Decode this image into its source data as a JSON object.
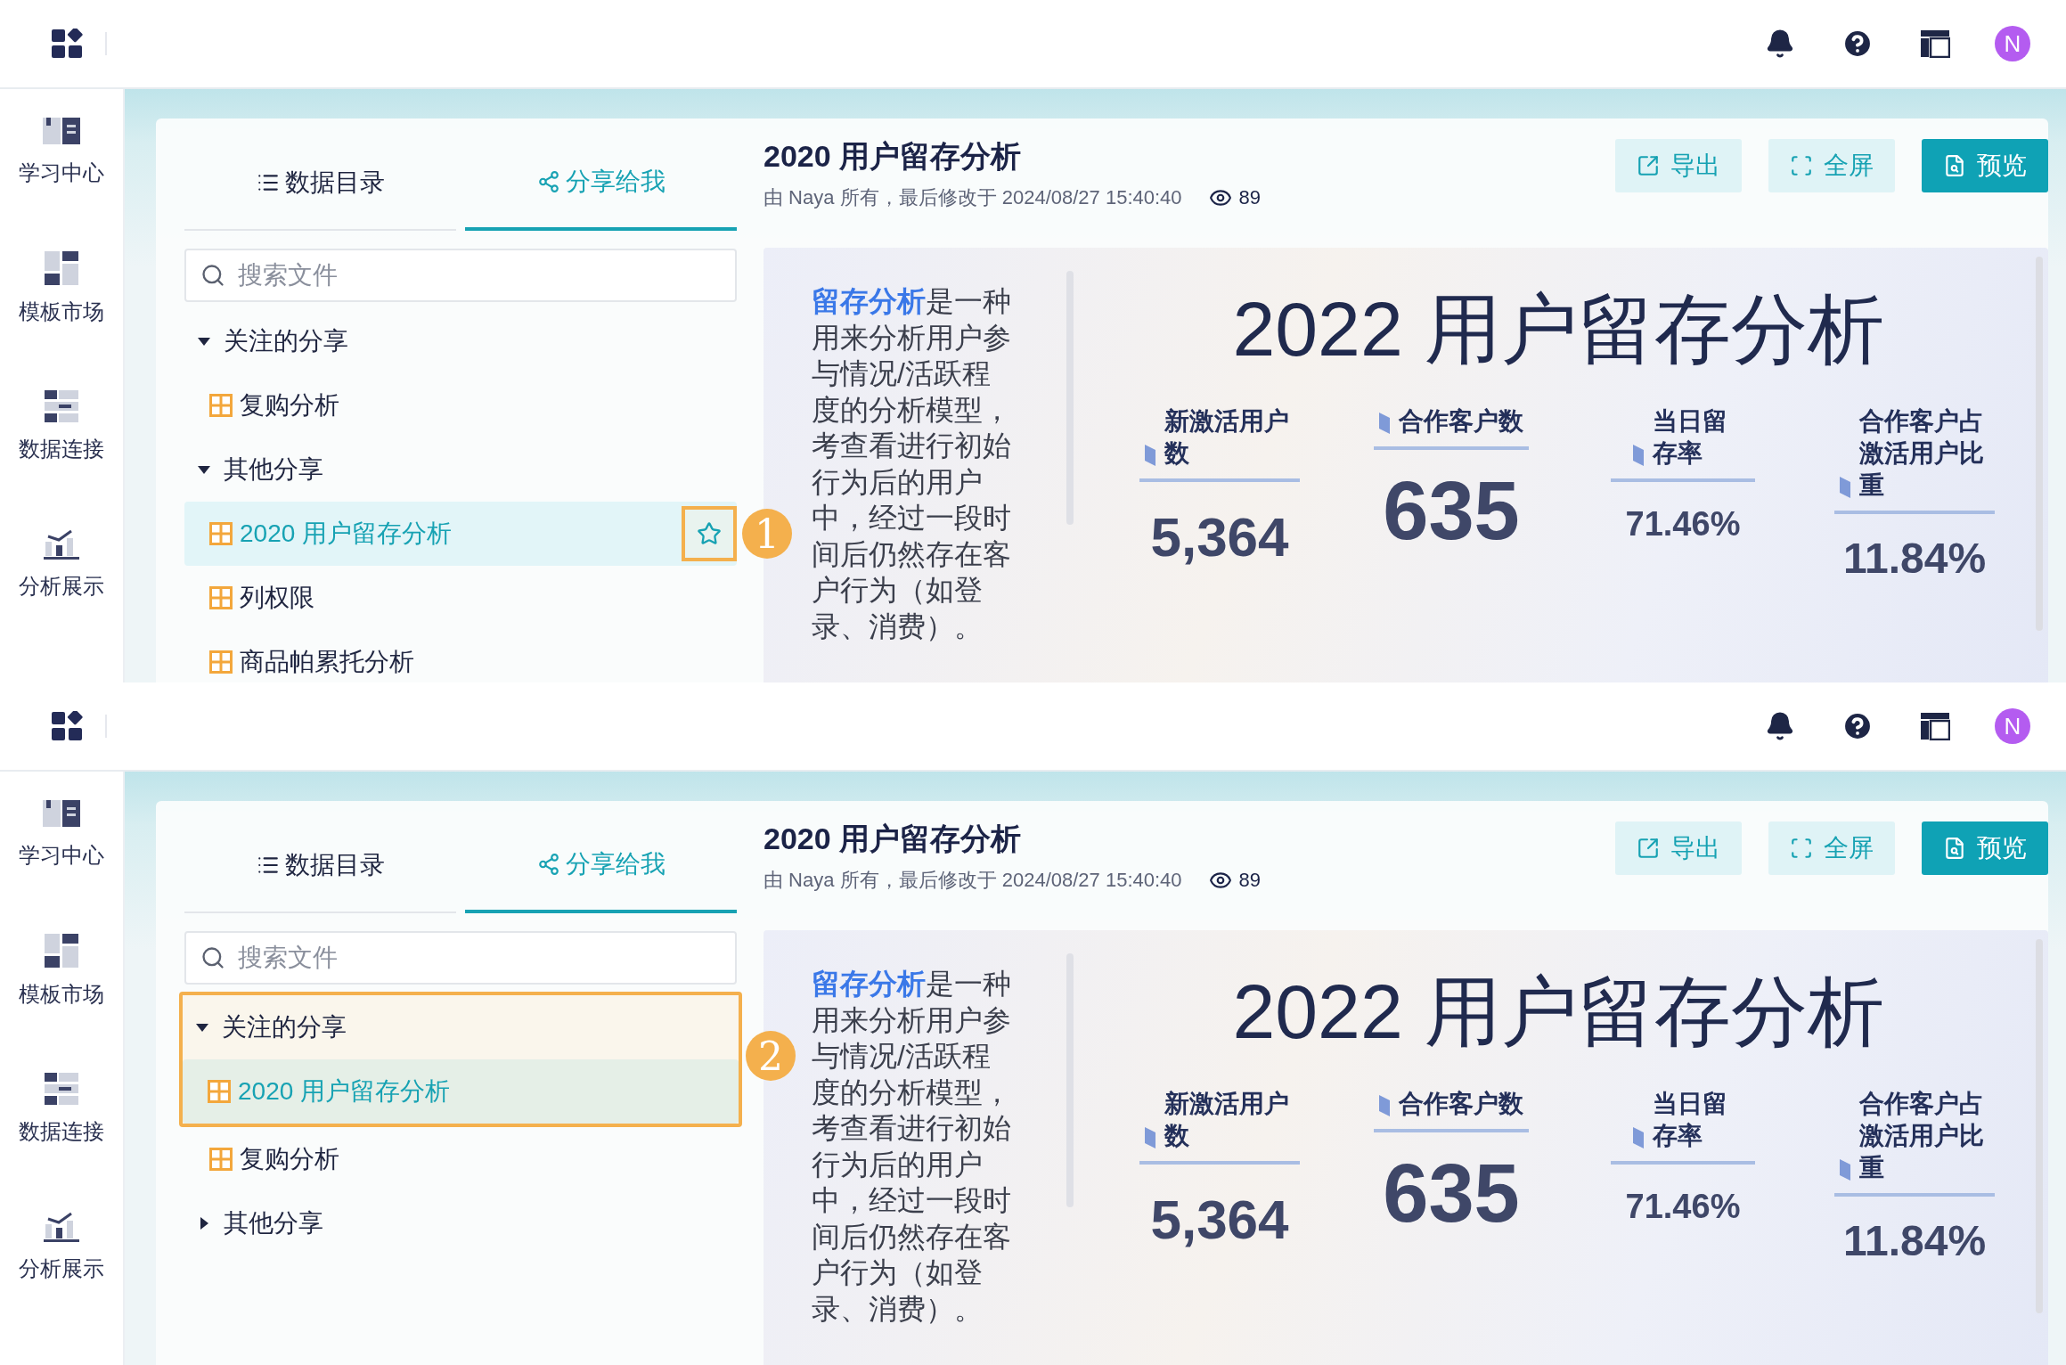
{
  "screens": [
    {
      "topbar": {
        "avatar": "N"
      },
      "sidebar": {
        "items": [
          {
            "label": "学习中心"
          },
          {
            "label": "模板市场"
          },
          {
            "label": "数据连接"
          },
          {
            "label": "分析展示"
          }
        ]
      },
      "tabs": [
        {
          "label": "数据目录",
          "kind": "catalog",
          "selected": false
        },
        {
          "label": "分享给我",
          "kind": "share",
          "selected": true
        }
      ],
      "search": {
        "placeholder": "搜索文件"
      },
      "tree": [
        {
          "kind": "group",
          "label": "关注的分享",
          "expanded": true,
          "children": [
            {
              "kind": "file",
              "label": "复购分析",
              "selected": false
            }
          ]
        },
        {
          "kind": "group",
          "label": "其他分享",
          "expanded": true,
          "children": [
            {
              "kind": "file",
              "label": "2020 用户留存分析",
              "selected": true,
              "star": {
                "highlighted": true
              },
              "callout": "1"
            },
            {
              "kind": "file",
              "label": "列权限",
              "selected": false
            },
            {
              "kind": "file",
              "label": "商品帕累托分析",
              "selected": false
            }
          ]
        }
      ],
      "document": {
        "title": "2020 用户留存分析",
        "meta": "由 Naya 所有，最后修改于 2024/08/27 15:40:40",
        "views": "89",
        "buttons": [
          {
            "label": "导出",
            "kind": "export"
          },
          {
            "label": "全屏",
            "kind": "fullscreen"
          },
          {
            "label": "预览",
            "kind": "preview"
          }
        ]
      },
      "canvas": {
        "description": "**留存分析**是一种用来分析用户参与情况/活跃程度的分析模型，考查看进行初始行为后的用户中，经过一段时间后仍然存在客户行为（如登录、消费）。",
        "title": "2022 用户留存分析",
        "kpis": [
          {
            "label": "新激活用户数",
            "value": "5,364"
          },
          {
            "label": "合作客户数",
            "value": "635"
          },
          {
            "label": "当日留存率",
            "value": "71.46%"
          },
          {
            "label": "合作客户占激活用户比重",
            "value": "11.84%"
          }
        ]
      }
    },
    {
      "topbar": {
        "avatar": "N"
      },
      "sidebar": {
        "items": [
          {
            "label": "学习中心"
          },
          {
            "label": "模板市场"
          },
          {
            "label": "数据连接"
          },
          {
            "label": "分析展示"
          }
        ]
      },
      "tabs": [
        {
          "label": "数据目录",
          "kind": "catalog",
          "selected": false
        },
        {
          "label": "分享给我",
          "kind": "share",
          "selected": true
        }
      ],
      "search": {
        "placeholder": "搜索文件"
      },
      "tree": [
        {
          "kind": "group",
          "label": "关注的分享",
          "expanded": true,
          "highlighted": true,
          "callout": "2",
          "children": [
            {
              "kind": "file",
              "label": "2020 用户留存分析",
              "selected": true,
              "highlighted": true
            },
            {
              "kind": "file",
              "label": "复购分析",
              "selected": false,
              "highlighted": false
            }
          ]
        },
        {
          "kind": "group",
          "label": "其他分享",
          "expanded": false,
          "highlighted": false
        }
      ],
      "document": {
        "title": "2020 用户留存分析",
        "meta": "由 Naya 所有，最后修改于 2024/08/27 15:40:40",
        "views": "89",
        "buttons": [
          {
            "label": "导出",
            "kind": "export"
          },
          {
            "label": "全屏",
            "kind": "fullscreen"
          },
          {
            "label": "预览",
            "kind": "preview"
          }
        ]
      },
      "canvas": {
        "description": "**留存分析**是一种用来分析用户参与情况/活跃程度的分析模型，考查看进行初始行为后的用户中，经过一段时间后仍然存在客户行为（如登录、消费）。",
        "title": "2022 用户留存分析",
        "kpis": [
          {
            "label": "新激活用户数",
            "value": "5,364"
          },
          {
            "label": "合作客户数",
            "value": "635"
          },
          {
            "label": "当日留存率",
            "value": "71.46%"
          },
          {
            "label": "合作客户占激活用户比重",
            "value": "11.84%"
          }
        ]
      }
    }
  ]
}
